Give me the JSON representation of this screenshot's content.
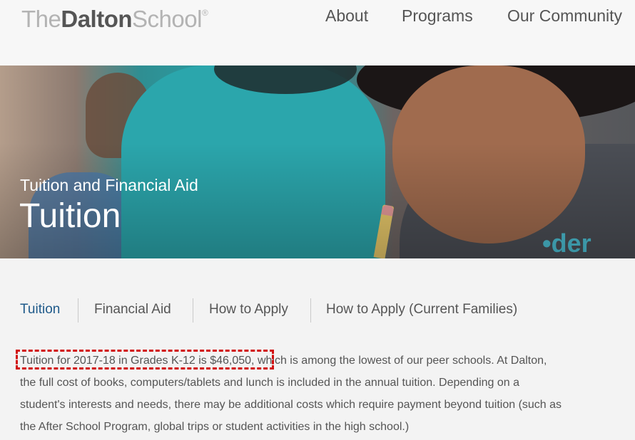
{
  "header": {
    "logo": {
      "part1": "The",
      "part2": "Dalton",
      "part3": "School",
      "mark": "®"
    },
    "nav": [
      {
        "label": "About"
      },
      {
        "label": "Programs"
      },
      {
        "label": "Our Community"
      }
    ]
  },
  "hero": {
    "subtitle": "Tuition and Financial Aid",
    "title": "Tuition"
  },
  "subnav": {
    "items": [
      {
        "label": "Tuition",
        "active": true
      },
      {
        "label": "Financial Aid"
      },
      {
        "label": "How to Apply"
      },
      {
        "label": "How to Apply (Current Families)"
      }
    ]
  },
  "content": {
    "highlighted": "Tuition for 2017-18 in Grades K-12 is $46,050,",
    "line1_rest": " which is among the lowest of our peer schools. At Dalton,",
    "line2": "the full cost of books, computers/tablets and lunch is included in the annual tuition.  Depending on a",
    "line3": "student's interests and needs, there may be additional costs which require payment beyond tuition (such as",
    "line4": "the After School Program, global trips or student activities in the high school.)"
  },
  "colors": {
    "accent": "#1f5a8a",
    "highlight_border": "#d10f0f",
    "text": "#555555"
  }
}
